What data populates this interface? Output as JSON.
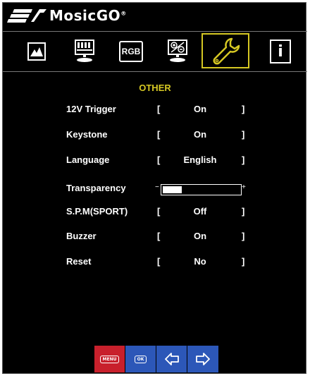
{
  "brand": {
    "name": "MosicGO",
    "registered": "®"
  },
  "tabs": [
    {
      "name": "tab-picture",
      "icon": "picture-icon"
    },
    {
      "name": "tab-display",
      "icon": "projector-icon"
    },
    {
      "name": "tab-rgb",
      "icon": "rgb-icon",
      "label": "RGB"
    },
    {
      "name": "tab-adjust",
      "icon": "plus-minus-screen-icon"
    },
    {
      "name": "tab-other",
      "icon": "wrench-icon",
      "active": true
    },
    {
      "name": "tab-info",
      "icon": "info-icon",
      "label": "i"
    }
  ],
  "menu": {
    "title": "OTHER",
    "items": [
      {
        "label": "12V Trigger",
        "value": "On"
      },
      {
        "label": "Keystone",
        "value": "On"
      },
      {
        "label": "Language",
        "value": "English"
      },
      {
        "label": "Transparency",
        "min_symbol": "−",
        "max_symbol": "+",
        "level_fraction": 0.25
      },
      {
        "label": "S.P.M(SPORT)",
        "value": "Off"
      },
      {
        "label": "Buzzer",
        "value": "On"
      },
      {
        "label": "Reset",
        "value": "No"
      }
    ],
    "bracket_left": "[",
    "bracket_right": "]"
  },
  "buttons": {
    "menu": "MENU",
    "ok": "OK",
    "left": "left-arrow-icon",
    "right": "right-arrow-icon"
  },
  "colors": {
    "accent": "#d6c823",
    "menu_button": "#c8202c",
    "nav_button": "#2c57b8",
    "background": "#000000"
  }
}
